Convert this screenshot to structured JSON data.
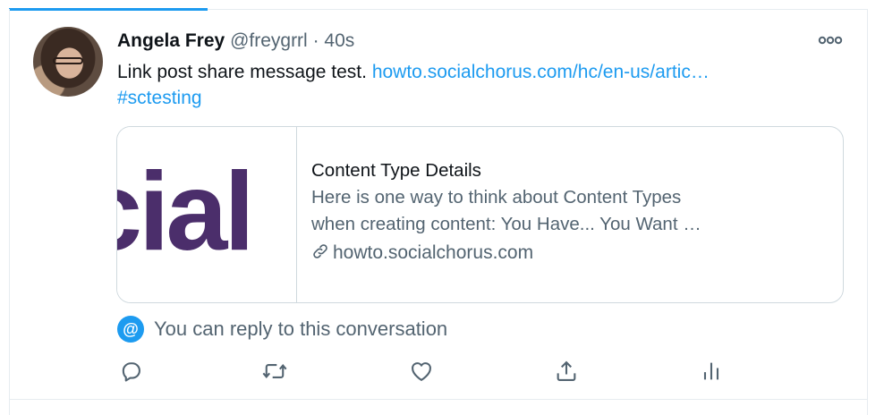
{
  "tweet": {
    "author_name": "Angela Frey",
    "author_handle": "@freygrrl",
    "separator": "·",
    "timestamp": "40s",
    "text": "Link post share message test.",
    "link_text": "howto.socialchorus.com/hc/en-us/artic…",
    "hashtag": "#sctesting"
  },
  "card": {
    "logo_text": "cial",
    "title": "Content Type Details",
    "description_line1": "Here is one way to think about Content Types",
    "description_line2": "when creating content:    You Have... You Want …",
    "domain": "howto.socialchorus.com"
  },
  "reply_notice": {
    "badge": "@",
    "text": "You can reply to this conversation"
  },
  "icons": {
    "more": "more-icon",
    "reply": "reply-icon",
    "retweet": "retweet-icon",
    "like": "heart-icon",
    "share": "share-icon",
    "analytics": "analytics-icon",
    "link": "link-icon"
  },
  "colors": {
    "accent": "#1d9bf0",
    "secondary_text": "#536471",
    "border": "#cfd9de",
    "logo_purple": "#4b2e6b"
  }
}
